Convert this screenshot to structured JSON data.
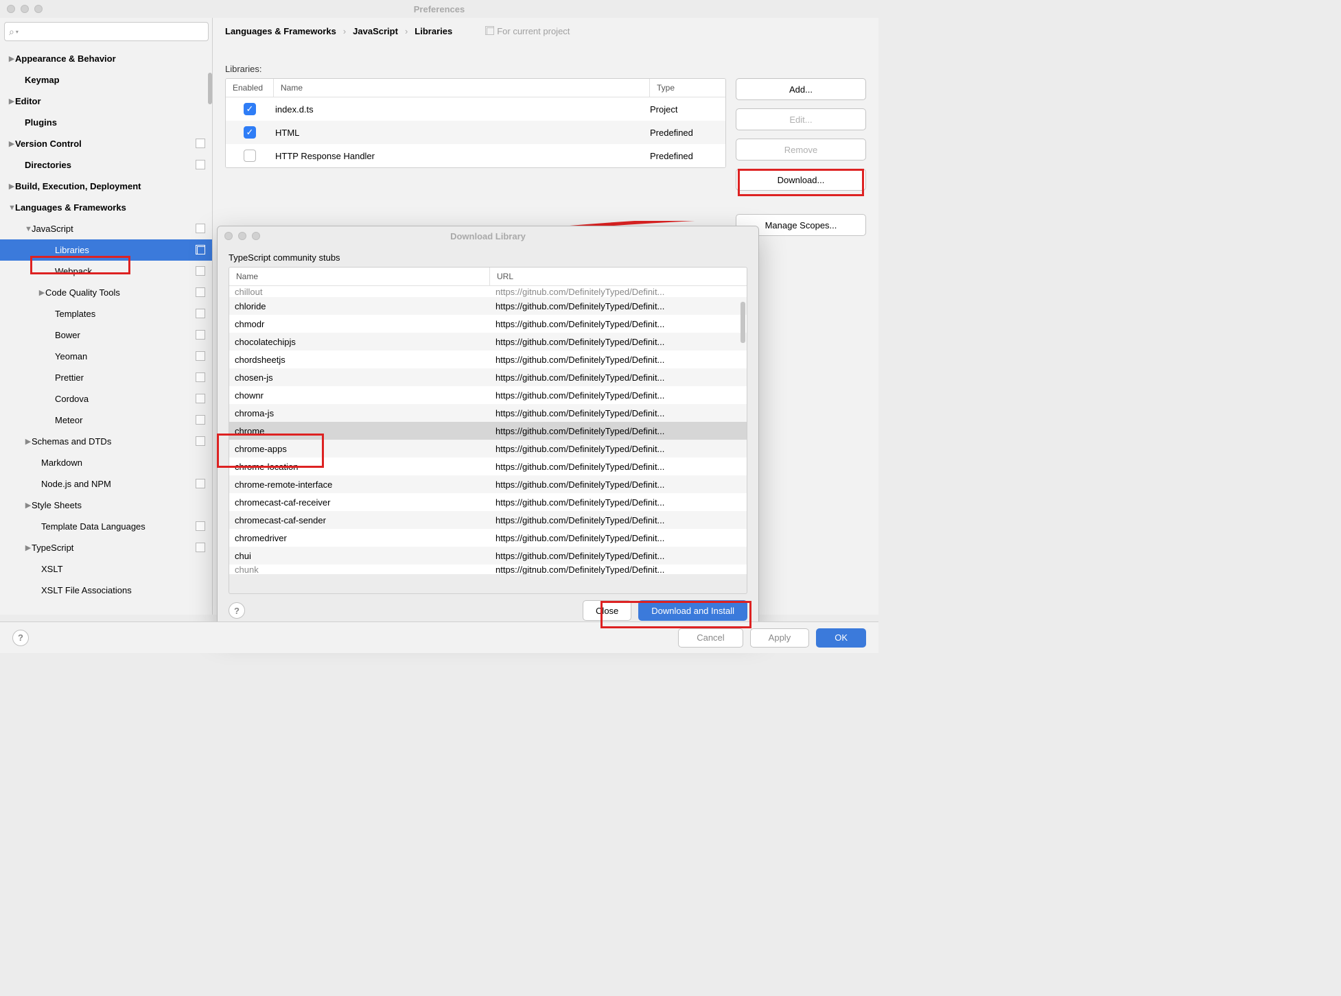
{
  "window": {
    "title": "Preferences"
  },
  "search": {
    "placeholder": ""
  },
  "sidebar": [
    {
      "indent": 12,
      "arrow": "▶",
      "bold": true,
      "label": "Appearance & Behavior"
    },
    {
      "indent": 26,
      "arrow": "",
      "bold": true,
      "label": "Keymap"
    },
    {
      "indent": 12,
      "arrow": "▶",
      "bold": true,
      "label": "Editor"
    },
    {
      "indent": 26,
      "arrow": "",
      "bold": true,
      "label": "Plugins"
    },
    {
      "indent": 12,
      "arrow": "▶",
      "bold": true,
      "label": "Version Control",
      "copy": true
    },
    {
      "indent": 26,
      "arrow": "",
      "bold": true,
      "label": "Directories",
      "copy": true
    },
    {
      "indent": 12,
      "arrow": "▶",
      "bold": true,
      "label": "Build, Execution, Deployment"
    },
    {
      "indent": 12,
      "arrow": "▼",
      "bold": true,
      "label": "Languages & Frameworks"
    },
    {
      "indent": 36,
      "arrow": "▼",
      "bold": false,
      "label": "JavaScript",
      "copy": true
    },
    {
      "indent": 70,
      "arrow": "",
      "bold": false,
      "label": "Libraries",
      "copy": true,
      "selected": true
    },
    {
      "indent": 70,
      "arrow": "",
      "bold": false,
      "label": "Webpack",
      "copy": true
    },
    {
      "indent": 56,
      "arrow": "▶",
      "bold": false,
      "label": "Code Quality Tools",
      "copy": true
    },
    {
      "indent": 70,
      "arrow": "",
      "bold": false,
      "label": "Templates",
      "copy": true
    },
    {
      "indent": 70,
      "arrow": "",
      "bold": false,
      "label": "Bower",
      "copy": true
    },
    {
      "indent": 70,
      "arrow": "",
      "bold": false,
      "label": "Yeoman",
      "copy": true
    },
    {
      "indent": 70,
      "arrow": "",
      "bold": false,
      "label": "Prettier",
      "copy": true
    },
    {
      "indent": 70,
      "arrow": "",
      "bold": false,
      "label": "Cordova",
      "copy": true
    },
    {
      "indent": 70,
      "arrow": "",
      "bold": false,
      "label": "Meteor",
      "copy": true
    },
    {
      "indent": 36,
      "arrow": "▶",
      "bold": false,
      "label": "Schemas and DTDs",
      "copy": true
    },
    {
      "indent": 50,
      "arrow": "",
      "bold": false,
      "label": "Markdown"
    },
    {
      "indent": 50,
      "arrow": "",
      "bold": false,
      "label": "Node.js and NPM",
      "copy": true
    },
    {
      "indent": 36,
      "arrow": "▶",
      "bold": false,
      "label": "Style Sheets"
    },
    {
      "indent": 50,
      "arrow": "",
      "bold": false,
      "label": "Template Data Languages",
      "copy": true
    },
    {
      "indent": 36,
      "arrow": "▶",
      "bold": false,
      "label": "TypeScript",
      "copy": true
    },
    {
      "indent": 50,
      "arrow": "",
      "bold": false,
      "label": "XSLT"
    },
    {
      "indent": 50,
      "arrow": "",
      "bold": false,
      "label": "XSLT File Associations"
    }
  ],
  "breadcrumb": {
    "a": "Languages & Frameworks",
    "b": "JavaScript",
    "c": "Libraries",
    "hint": "For current project"
  },
  "libs": {
    "label": "Libraries:",
    "head": {
      "en": "Enabled",
      "nm": "Name",
      "ty": "Type"
    },
    "rows": [
      {
        "enabled": true,
        "name": "index.d.ts",
        "type": "Project"
      },
      {
        "enabled": true,
        "name": "HTML",
        "type": "Predefined"
      },
      {
        "enabled": false,
        "name": "HTTP Response Handler",
        "type": "Predefined"
      }
    ]
  },
  "buttons": {
    "add": "Add...",
    "edit": "Edit...",
    "remove": "Remove",
    "download": "Download...",
    "scopes": "Manage Scopes..."
  },
  "dialog": {
    "title": "Download Library",
    "subtitle": "TypeScript community stubs",
    "head": {
      "n": "Name",
      "u": "URL"
    },
    "url_trunc": "https://github.com/DefinitelyTyped/Definit...",
    "url_faded": "nttps://gitnub.com/DefinitelyTyped/Definit...",
    "rows": [
      {
        "n": "chillout",
        "faded": true
      },
      {
        "n": "chloride"
      },
      {
        "n": "chmodr"
      },
      {
        "n": "chocolatechipjs"
      },
      {
        "n": "chordsheetjs"
      },
      {
        "n": "chosen-js"
      },
      {
        "n": "chownr"
      },
      {
        "n": "chroma-js"
      },
      {
        "n": "chrome",
        "selected": true
      },
      {
        "n": "chrome-apps"
      },
      {
        "n": "chrome-location"
      },
      {
        "n": "chrome-remote-interface"
      },
      {
        "n": "chromecast-caf-receiver"
      },
      {
        "n": "chromecast-caf-sender"
      },
      {
        "n": "chromedriver"
      },
      {
        "n": "chui"
      },
      {
        "n": "chunk",
        "bottom": true
      }
    ],
    "close": "Close",
    "install": "Download and Install"
  },
  "footer": {
    "cancel": "Cancel",
    "apply": "Apply",
    "ok": "OK"
  }
}
